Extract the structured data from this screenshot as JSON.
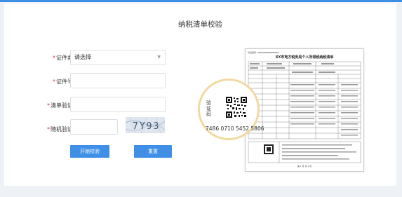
{
  "page": {
    "title": "纳税清单校验"
  },
  "form": {
    "fields": [
      {
        "label": "证件类型：",
        "value": "请选择",
        "type": "select"
      },
      {
        "label": "证件号码：",
        "value": "",
        "type": "text"
      },
      {
        "label": "清单验证码：",
        "value": "",
        "type": "text"
      },
      {
        "label": "随机验证码：",
        "value": "",
        "type": "text"
      }
    ],
    "required_mark": "*",
    "captcha_text": "7Y93",
    "buttons": {
      "submit": "开始校验",
      "reset": "重置"
    }
  },
  "sample_doc": {
    "number_label": "凭证编号: 9886988888888888",
    "title": "XX市地方税务局个人所得税纳税清单",
    "page_label": "第 1 页 共 1 页"
  },
  "magnifier": {
    "label": "验证码",
    "code": "7486 0710 5452 5806"
  },
  "colors": {
    "accent": "#3f8fe6",
    "required": "#e0302f",
    "topbar": "#3d8ee5"
  }
}
